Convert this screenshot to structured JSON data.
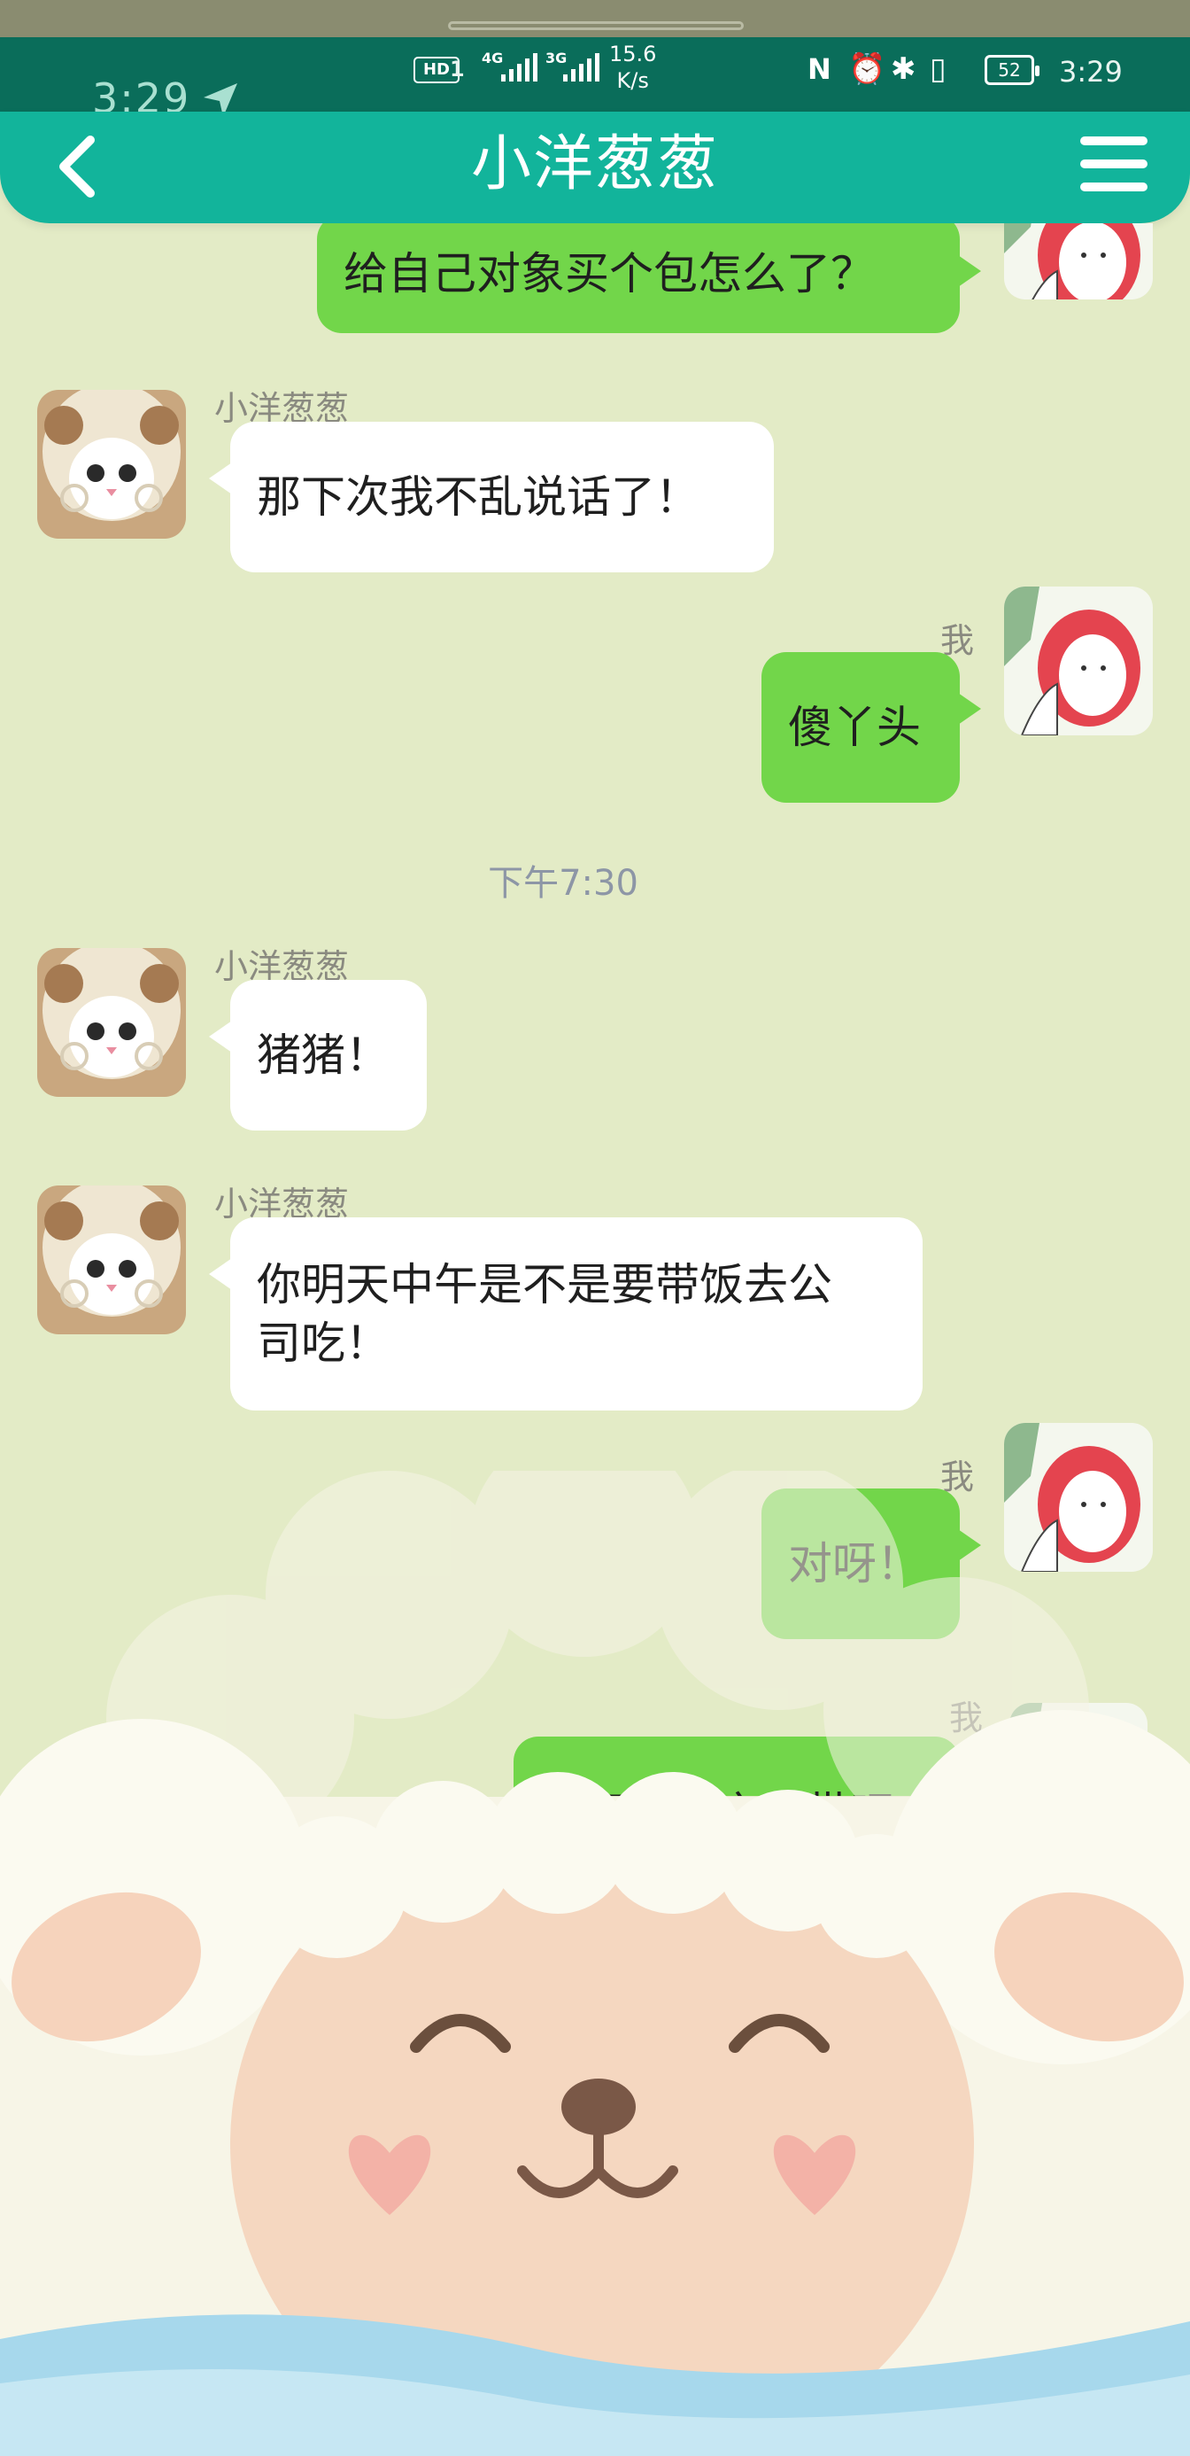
{
  "status_bar": {
    "time": "3:29",
    "hd_label": "HD",
    "sim_slot": "1",
    "network_1": "4G",
    "network_2": "3G",
    "speed_value": "15.6",
    "speed_unit": "K/s",
    "battery": "52",
    "nfc_icon": "N"
  },
  "ghost_time": "3:29",
  "header": {
    "title": "小洋葱葱"
  },
  "messages": [
    {
      "sender": "me",
      "text": "给自己对象买个包怎么了？"
    },
    {
      "sender": "other",
      "name": "小洋葱葱",
      "text": "那下次我不乱说话了！"
    },
    {
      "sender": "me",
      "name": "我",
      "text": "傻丫头"
    },
    {
      "type": "timestamp",
      "text": "下午7:30"
    },
    {
      "sender": "other",
      "name": "小洋葱葱",
      "text": "猪猪！"
    },
    {
      "sender": "other",
      "name": "小洋葱葱",
      "text_line1": "你明天中午是不是要带饭去公",
      "text_line2": "司吃！"
    },
    {
      "sender": "me",
      "name": "我",
      "text": "对呀！"
    },
    {
      "sender": "me",
      "name": "我",
      "text": "我下午都之可带吧"
    }
  ],
  "colors": {
    "background": "#e3ebc6",
    "header": "#12b49b",
    "status_bar": "#0a6d5a",
    "outgoing_bubble": "#72d64a",
    "incoming_bubble": "#ffffff"
  },
  "icons": {
    "back": "chevron-left-icon",
    "menu": "hamburger-menu-icon",
    "location": "location-arrow-icon"
  }
}
